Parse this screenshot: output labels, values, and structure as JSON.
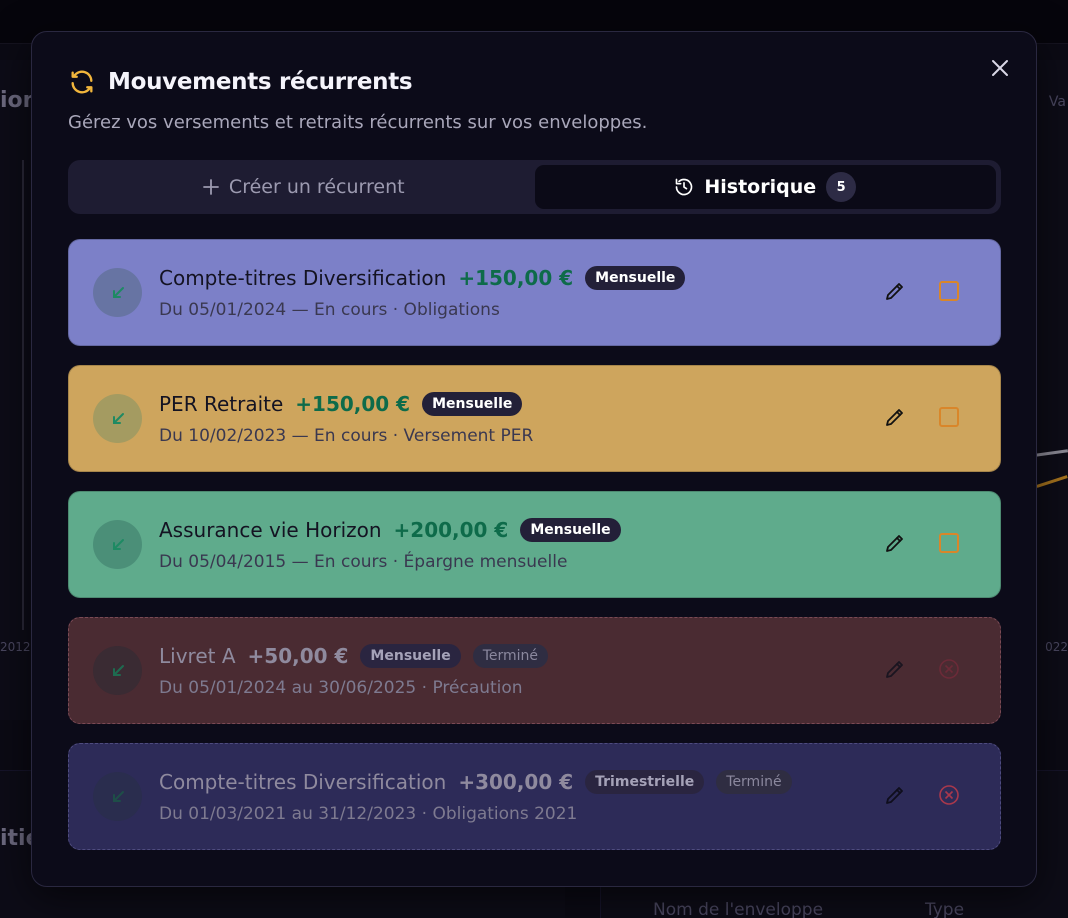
{
  "background": {
    "left_title_fragment": "ion",
    "left_bottom_fragment": "itie",
    "right_fragment": "Va",
    "table_header_name": "Nom de l'enveloppe",
    "table_header_type": "Type",
    "axis_year_left": "2012",
    "axis_year_right": "022"
  },
  "modal": {
    "title": "Mouvements récurrents",
    "subtitle": "Gérez vos versements et retraits récurrents sur vos enveloppes.",
    "title_icon": "refresh-icon",
    "close_icon": "close-icon"
  },
  "tabs": {
    "create_label": "Créer un récurrent",
    "history_label": "Historique",
    "history_count": "5"
  },
  "colors": {
    "accent": "#f2b63c",
    "positive_amount": "#0e6b4a",
    "stop_icon_active": "#d9862a",
    "stop_icon_ended": "#c0384e"
  },
  "items": [
    {
      "name": "Compte-titres Diversification",
      "amount": "+150,00 €",
      "frequency": "Mensuelle",
      "details": "Du 05/01/2024 — En cours · Obligations",
      "status": ""
    },
    {
      "name": "PER Retraite",
      "amount": "+150,00 €",
      "frequency": "Mensuelle",
      "details": "Du 10/02/2023 — En cours · Versement PER",
      "status": ""
    },
    {
      "name": "Assurance vie Horizon",
      "amount": "+200,00 €",
      "frequency": "Mensuelle",
      "details": "Du 05/04/2015 — En cours · Épargne mensuelle",
      "status": ""
    },
    {
      "name": "Livret A",
      "amount": "+50,00 €",
      "frequency": "Mensuelle",
      "details": "Du 05/01/2024 au 30/06/2025 · Précaution",
      "status": "Terminé"
    },
    {
      "name": "Compte-titres Diversification",
      "amount": "+300,00 €",
      "frequency": "Trimestrielle",
      "details": "Du 01/03/2021 au 31/12/2023 · Obligations 2021",
      "status": "Terminé"
    }
  ]
}
